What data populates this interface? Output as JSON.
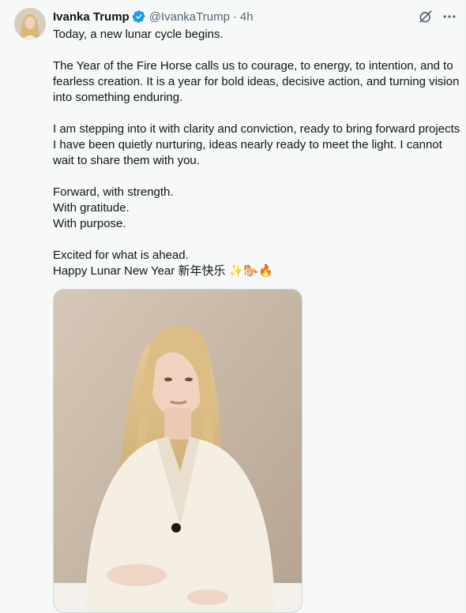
{
  "author": {
    "display_name": "Ivanka Trump",
    "handle": "@IvankaTrump",
    "separator": "·",
    "time": "4h",
    "verified": true
  },
  "icons": {
    "grok": "slashed-circle-icon",
    "more": "more-dots-icon",
    "verified": "verified-badge-icon"
  },
  "tweet": {
    "line1": "Today, a new lunar cycle begins.",
    "para2": "The Year of the Fire Horse calls us to courage, to energy, to intention, and to fearless creation. It is a year for bold ideas, decisive action, and turning vision into something enduring.",
    "para3": "I am stepping into it with clarity and conviction, ready to bring forward projects I have been quietly nurturing, ideas nearly ready to meet the light. I cannot wait to share them with you.",
    "line_forward": "Forward, with strength.",
    "line_gratitude": "With gratitude.",
    "line_purpose": "With purpose.",
    "line_excited": "Excited for what is ahead.",
    "line_lunar": "Happy Lunar New Year 新年快乐",
    "emojis": "✨🐎🔥"
  },
  "colors": {
    "verified_blue": "#1d9bf0",
    "secondary_text": "#536471",
    "background": "#f7f9f9"
  }
}
